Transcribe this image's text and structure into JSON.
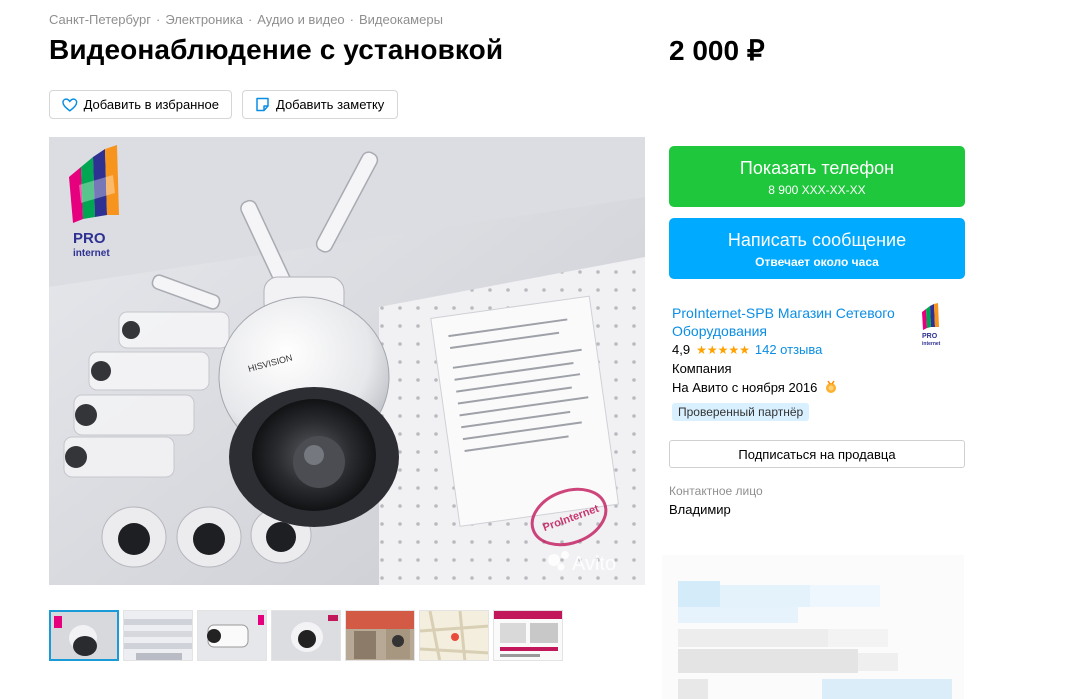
{
  "breadcrumbs": [
    "Санкт-Петербург",
    "Электроника",
    "Аудио и видео",
    "Видеокамеры"
  ],
  "breadcrumb_separator": "·",
  "title": "Видеонаблюдение с установкой",
  "price": "2 000 ₽",
  "actions": {
    "favorite_label": "Добавить в избранное",
    "note_label": "Добавить заметку"
  },
  "photo": {
    "watermark": "Avito",
    "logo_text_top": "PRO",
    "logo_text_bottom": "internet",
    "stamp_text": "ProInternet",
    "thumbnail_count": 7,
    "active_thumbnail": 1
  },
  "contact_buttons": {
    "phone_label": "Показать телефон",
    "phone_number": "8 900 XXX-XX-XX",
    "message_label": "Написать сообщение",
    "message_sub": "Отвечает около часа"
  },
  "seller": {
    "name": "ProInternet-SPB Магазин Сетевого Оборудования",
    "rating": "4,9",
    "stars": "★★★★★",
    "reviews": "142 отзыва",
    "type": "Компания",
    "since": "На Авито с ноября 2016",
    "badge": "Проверенный партнёр",
    "subscribe_label": "Подписаться на продавца",
    "logo_text_top": "PRO",
    "logo_text_bottom": "internet"
  },
  "contact": {
    "label": "Контактное лицо",
    "name": "Владимир"
  },
  "colors": {
    "phone_button": "#1ec73b",
    "message_button": "#00aaff",
    "link": "#0a8ee3",
    "star": "#ffa200",
    "badge_bg": "#d8f0ff",
    "active_thumb_border": "#1a9ad6"
  }
}
